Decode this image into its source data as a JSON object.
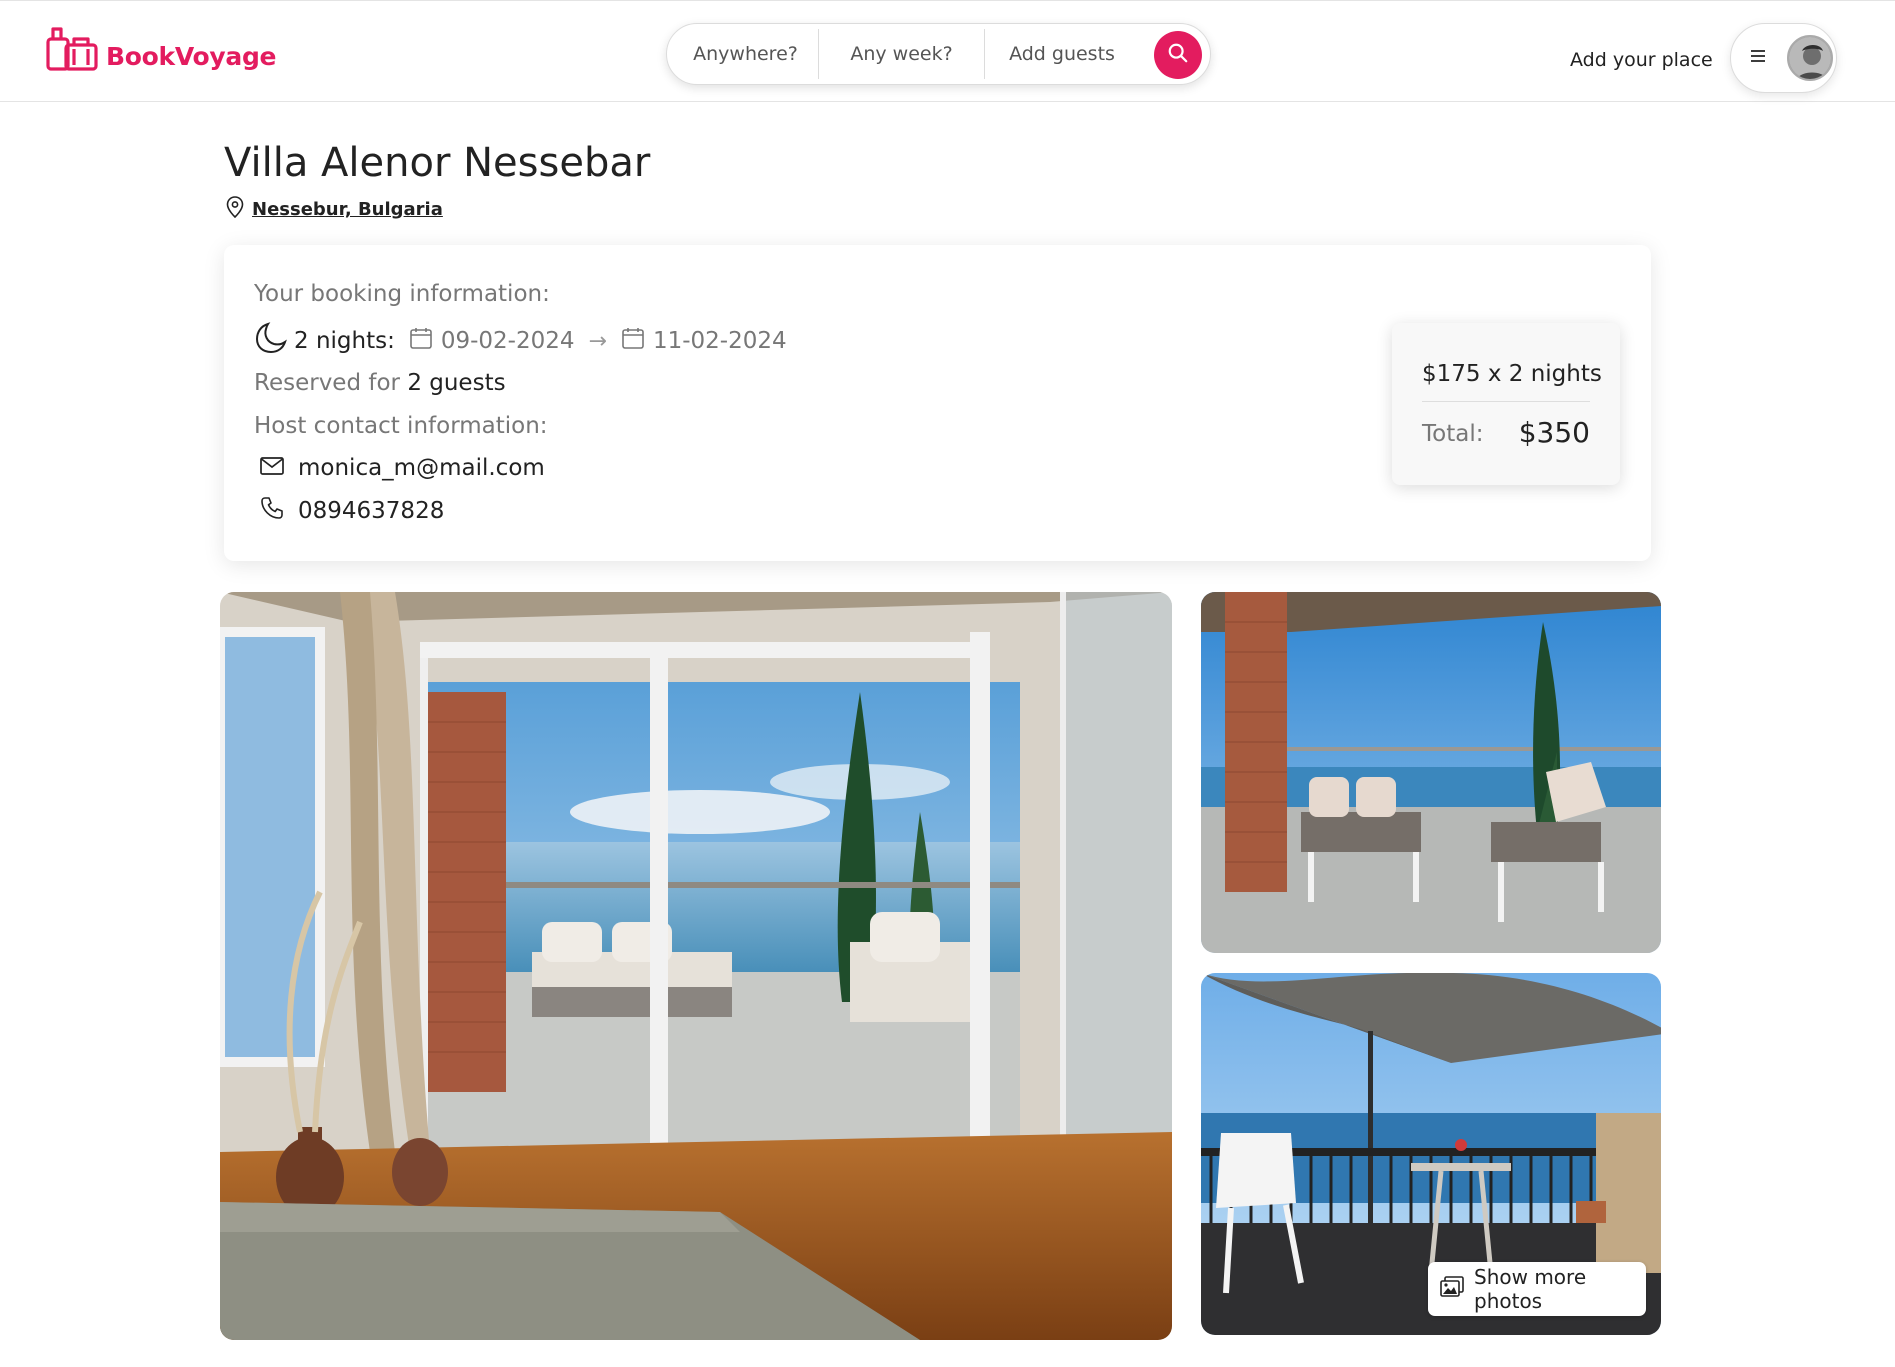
{
  "header": {
    "brand": "BookVoyage",
    "search": {
      "where": "Anywhere?",
      "when": "Any week?",
      "guests": "Add guests"
    },
    "add_place": "Add your place"
  },
  "listing": {
    "title": "Villa Alenor Nessebar",
    "location": "Nessebur, Bulgaria"
  },
  "booking": {
    "heading": "Your booking information:",
    "nights": "2 nights:",
    "check_in": "09-02-2024",
    "check_out": "11-02-2024",
    "reserved_prefix": "Reserved for",
    "reserved_guests": "2 guests",
    "host_heading": "Host contact information:",
    "host_email": "monica_m@mail.com",
    "host_phone": "0894637828"
  },
  "price": {
    "rate": "$175 x 2 nights",
    "total_label": "Total:",
    "total": "$350"
  },
  "photos": {
    "show_more": "Show more photos"
  },
  "colors": {
    "brand": "#e31c5f",
    "muted": "#777777",
    "text": "#222222"
  }
}
